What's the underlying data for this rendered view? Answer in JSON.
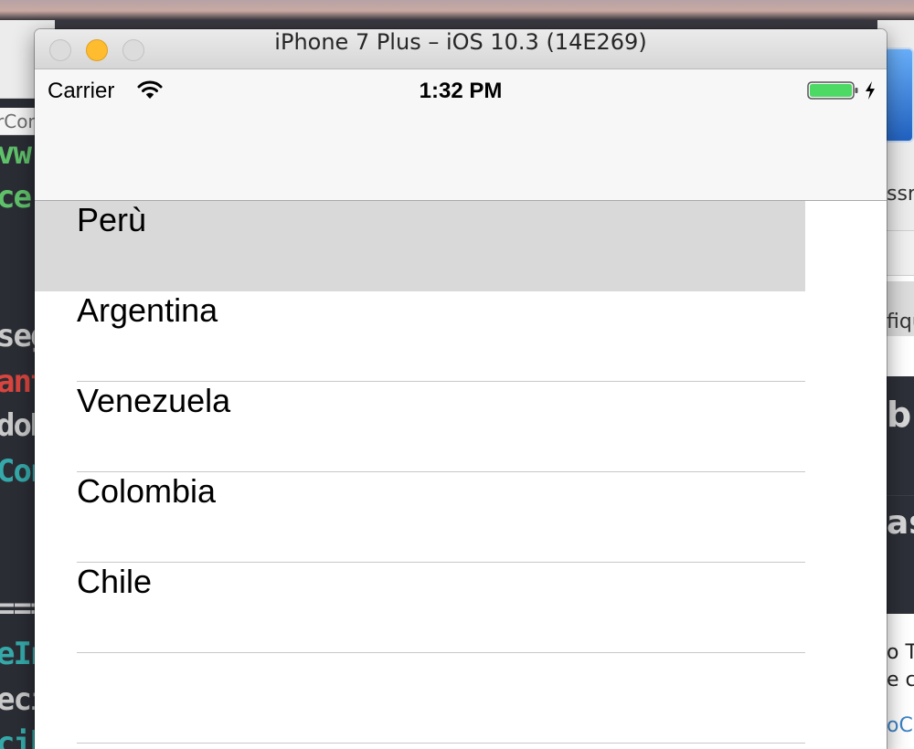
{
  "simulator": {
    "window_title": "iPhone 7 Plus – iOS 10.3 (14E269)"
  },
  "status_bar": {
    "carrier": "Carrier",
    "time": "1:32 PM",
    "battery_color": "#4cd964"
  },
  "table": {
    "rows": [
      {
        "label": "Perù",
        "selected": true
      },
      {
        "label": "Argentina",
        "selected": false
      },
      {
        "label": "Venezuela",
        "selected": false
      },
      {
        "label": "Colombia",
        "selected": false
      },
      {
        "label": "Chile",
        "selected": false
      },
      {
        "label": "",
        "selected": false
      }
    ]
  },
  "background": {
    "editor_breadcrumb": "rCon",
    "editor_code_fragments": [
      {
        "text": "vw",
        "color": "#5fc16a"
      },
      {
        "text": "ce",
        "color": "#5fc16a"
      },
      {
        "text": "seg",
        "color": "#c9c9c9"
      },
      {
        "text": "ant",
        "color": "#d9453e"
      },
      {
        "text": "doR",
        "color": "#c9c9c9"
      },
      {
        "text": "Con",
        "color": "#35a9a9"
      },
      {
        "text": "===",
        "color": "#c9c9c9"
      },
      {
        "text": "eIn",
        "color": "#35a9a9"
      },
      {
        "text": "eci",
        "color": "#c9c9c9"
      },
      {
        "text": "cib",
        "color": "#35a9a9"
      }
    ],
    "right_window_fragments": [
      "ssro",
      "fiqu",
      "bl",
      "as",
      "o T",
      "e cô",
      "oCo"
    ]
  }
}
